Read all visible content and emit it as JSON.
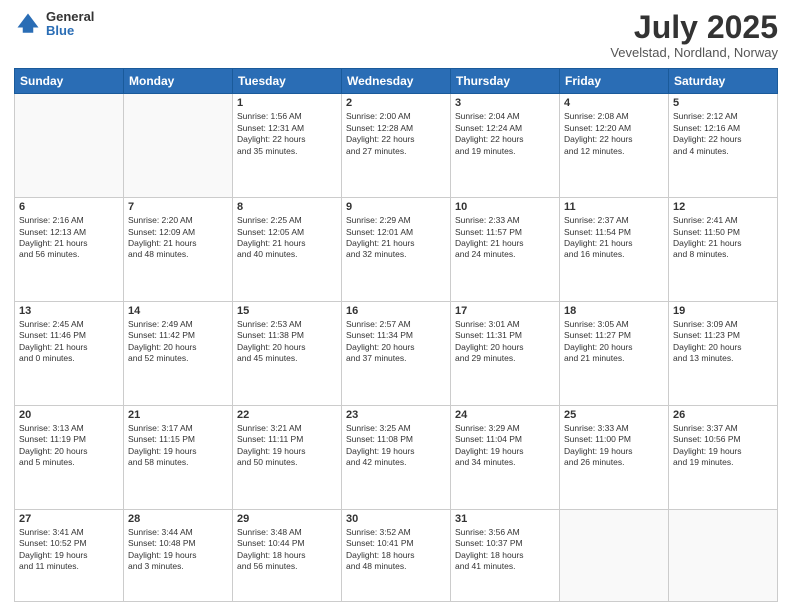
{
  "header": {
    "logo_general": "General",
    "logo_blue": "Blue",
    "month_title": "July 2025",
    "location": "Vevelstad, Nordland, Norway"
  },
  "days_of_week": [
    "Sunday",
    "Monday",
    "Tuesday",
    "Wednesday",
    "Thursday",
    "Friday",
    "Saturday"
  ],
  "weeks": [
    [
      {
        "day": "",
        "info": ""
      },
      {
        "day": "",
        "info": ""
      },
      {
        "day": "1",
        "info": "Sunrise: 1:56 AM\nSunset: 12:31 AM\nDaylight: 22 hours\nand 35 minutes."
      },
      {
        "day": "2",
        "info": "Sunrise: 2:00 AM\nSunset: 12:28 AM\nDaylight: 22 hours\nand 27 minutes."
      },
      {
        "day": "3",
        "info": "Sunrise: 2:04 AM\nSunset: 12:24 AM\nDaylight: 22 hours\nand 19 minutes."
      },
      {
        "day": "4",
        "info": "Sunrise: 2:08 AM\nSunset: 12:20 AM\nDaylight: 22 hours\nand 12 minutes."
      },
      {
        "day": "5",
        "info": "Sunrise: 2:12 AM\nSunset: 12:16 AM\nDaylight: 22 hours\nand 4 minutes."
      }
    ],
    [
      {
        "day": "6",
        "info": "Sunrise: 2:16 AM\nSunset: 12:13 AM\nDaylight: 21 hours\nand 56 minutes."
      },
      {
        "day": "7",
        "info": "Sunrise: 2:20 AM\nSunset: 12:09 AM\nDaylight: 21 hours\nand 48 minutes."
      },
      {
        "day": "8",
        "info": "Sunrise: 2:25 AM\nSunset: 12:05 AM\nDaylight: 21 hours\nand 40 minutes."
      },
      {
        "day": "9",
        "info": "Sunrise: 2:29 AM\nSunset: 12:01 AM\nDaylight: 21 hours\nand 32 minutes."
      },
      {
        "day": "10",
        "info": "Sunrise: 2:33 AM\nSunset: 11:57 PM\nDaylight: 21 hours\nand 24 minutes."
      },
      {
        "day": "11",
        "info": "Sunrise: 2:37 AM\nSunset: 11:54 PM\nDaylight: 21 hours\nand 16 minutes."
      },
      {
        "day": "12",
        "info": "Sunrise: 2:41 AM\nSunset: 11:50 PM\nDaylight: 21 hours\nand 8 minutes."
      }
    ],
    [
      {
        "day": "13",
        "info": "Sunrise: 2:45 AM\nSunset: 11:46 PM\nDaylight: 21 hours\nand 0 minutes."
      },
      {
        "day": "14",
        "info": "Sunrise: 2:49 AM\nSunset: 11:42 PM\nDaylight: 20 hours\nand 52 minutes."
      },
      {
        "day": "15",
        "info": "Sunrise: 2:53 AM\nSunset: 11:38 PM\nDaylight: 20 hours\nand 45 minutes."
      },
      {
        "day": "16",
        "info": "Sunrise: 2:57 AM\nSunset: 11:34 PM\nDaylight: 20 hours\nand 37 minutes."
      },
      {
        "day": "17",
        "info": "Sunrise: 3:01 AM\nSunset: 11:31 PM\nDaylight: 20 hours\nand 29 minutes."
      },
      {
        "day": "18",
        "info": "Sunrise: 3:05 AM\nSunset: 11:27 PM\nDaylight: 20 hours\nand 21 minutes."
      },
      {
        "day": "19",
        "info": "Sunrise: 3:09 AM\nSunset: 11:23 PM\nDaylight: 20 hours\nand 13 minutes."
      }
    ],
    [
      {
        "day": "20",
        "info": "Sunrise: 3:13 AM\nSunset: 11:19 PM\nDaylight: 20 hours\nand 5 minutes."
      },
      {
        "day": "21",
        "info": "Sunrise: 3:17 AM\nSunset: 11:15 PM\nDaylight: 19 hours\nand 58 minutes."
      },
      {
        "day": "22",
        "info": "Sunrise: 3:21 AM\nSunset: 11:11 PM\nDaylight: 19 hours\nand 50 minutes."
      },
      {
        "day": "23",
        "info": "Sunrise: 3:25 AM\nSunset: 11:08 PM\nDaylight: 19 hours\nand 42 minutes."
      },
      {
        "day": "24",
        "info": "Sunrise: 3:29 AM\nSunset: 11:04 PM\nDaylight: 19 hours\nand 34 minutes."
      },
      {
        "day": "25",
        "info": "Sunrise: 3:33 AM\nSunset: 11:00 PM\nDaylight: 19 hours\nand 26 minutes."
      },
      {
        "day": "26",
        "info": "Sunrise: 3:37 AM\nSunset: 10:56 PM\nDaylight: 19 hours\nand 19 minutes."
      }
    ],
    [
      {
        "day": "27",
        "info": "Sunrise: 3:41 AM\nSunset: 10:52 PM\nDaylight: 19 hours\nand 11 minutes."
      },
      {
        "day": "28",
        "info": "Sunrise: 3:44 AM\nSunset: 10:48 PM\nDaylight: 19 hours\nand 3 minutes."
      },
      {
        "day": "29",
        "info": "Sunrise: 3:48 AM\nSunset: 10:44 PM\nDaylight: 18 hours\nand 56 minutes."
      },
      {
        "day": "30",
        "info": "Sunrise: 3:52 AM\nSunset: 10:41 PM\nDaylight: 18 hours\nand 48 minutes."
      },
      {
        "day": "31",
        "info": "Sunrise: 3:56 AM\nSunset: 10:37 PM\nDaylight: 18 hours\nand 41 minutes."
      },
      {
        "day": "",
        "info": ""
      },
      {
        "day": "",
        "info": ""
      }
    ]
  ]
}
